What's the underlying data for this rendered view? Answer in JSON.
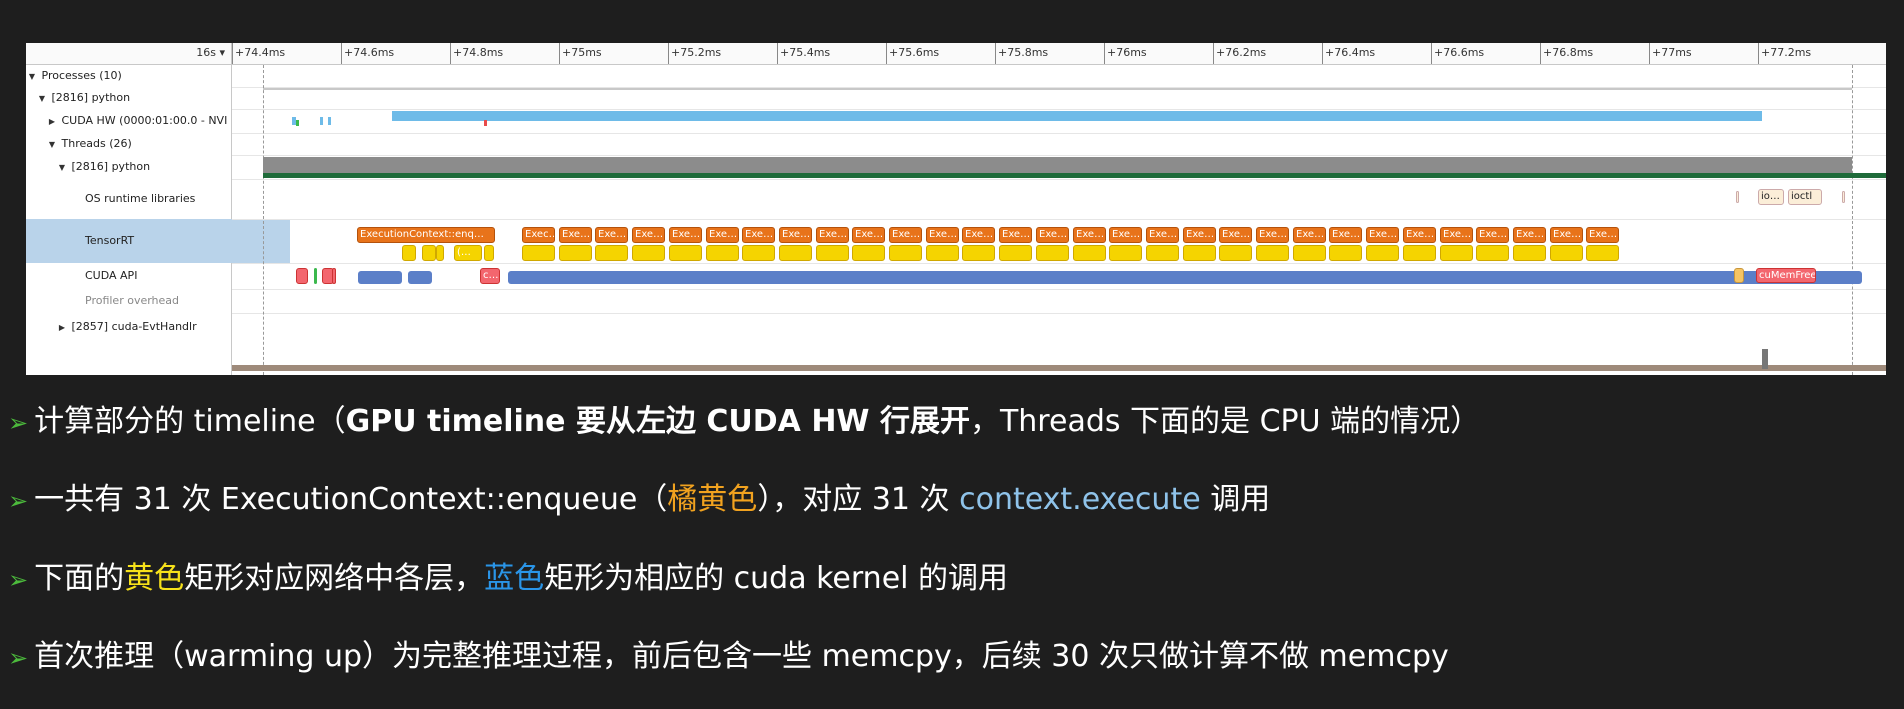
{
  "timeline": {
    "scale_button": "16s ▾",
    "ticks": [
      "+74.4ms",
      "+74.6ms",
      "+74.8ms",
      "+75ms",
      "+75.2ms",
      "+75.4ms",
      "+75.6ms",
      "+75.8ms",
      "+76ms",
      "+76.2ms",
      "+76.4ms",
      "+76.6ms",
      "+76.8ms",
      "+77ms",
      "+77.2ms"
    ],
    "rows": {
      "processes": "Processes (10)",
      "python_process": "[2816] python",
      "cuda_hw": "CUDA HW (0000:01:00.0 - NVI",
      "threads": "Threads (26)",
      "python_thread": "[2816] python",
      "os_runtime": "OS runtime libraries",
      "tensorrt": "TensorRT",
      "cuda_api": "CUDA API",
      "profiler_overhead": "Profiler overhead",
      "evt_handler": "[2857] cuda-EvtHandlr"
    },
    "blocks": {
      "first_enqueue": "ExecutionContext::enq…",
      "enqueue_short": "Exec…",
      "enqueue_tiny": "Exe…",
      "small_yellow": "(…",
      "cuda_api_small": "c…",
      "io": "io…",
      "ioctl": "ioctl",
      "cumemfree": "cuMemFree"
    }
  },
  "notes": [
    {
      "pre": "计算部分的 timeline（",
      "bold": "GPU timeline 要从左边 CUDA HW 行展开",
      "post": "，Threads 下面的是 CPU 端的情况）"
    },
    {
      "pre": "一共有 31 次 ExecutionContext::enqueue（",
      "orange": "橘黄色",
      "mid": "），对应 31 次 ",
      "lightblue": "context.execute",
      "post": " 调用"
    },
    {
      "pre": "下面的",
      "yellow": "黄色",
      "mid": "矩形对应网络中各层，",
      "blue": "蓝色",
      "post": "矩形为相应的 cuda kernel 的调用"
    },
    {
      "pre": "首次推理（warming up）为完整推理过程，前后包含一些 memcpy，后续 30 次只做计算不做 memcpy"
    }
  ],
  "colors": {
    "enqueue": "#e8731a",
    "layer": "#f5d400",
    "kernel": "#6ebbe8",
    "cuda_api": "#5b7fc8",
    "arrow": "#4cbb3c"
  }
}
